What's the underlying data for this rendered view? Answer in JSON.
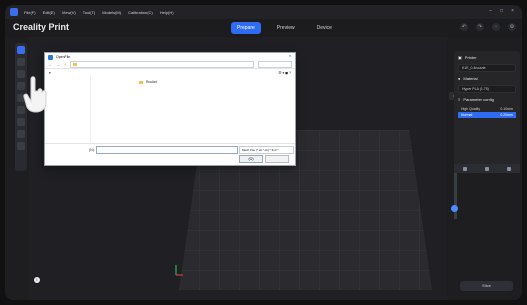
{
  "menubar": {
    "items": [
      "File(F)",
      "Edit(E)",
      "View(V)",
      "Tool(T)",
      "Models(M)",
      "Calibration(C)",
      "Help(H)"
    ]
  },
  "app": {
    "name": "Creality Print"
  },
  "tabs": [
    {
      "label": "Prepare"
    },
    {
      "label": "Preview"
    },
    {
      "label": "Device"
    }
  ],
  "dialog": {
    "title": "OpenFile",
    "folder_item": "Rocket",
    "filename_label": "(N):",
    "filter": "Mesh File (*.stl *.obj *.3mf *.",
    "open_label": "(O)"
  },
  "right_panel": {
    "printer": {
      "title": "Printer",
      "value": "K1E_0.4nozzle"
    },
    "material": {
      "title": "Material",
      "value": "Hyper PLA (1.75)"
    },
    "param": {
      "title": "Parameter config",
      "rows": [
        {
          "name": "High Quality",
          "value": "0.10mm"
        },
        {
          "name": "Normal",
          "value": "0.20mm"
        }
      ]
    }
  },
  "slice": {
    "label": "Slice"
  },
  "colors": {
    "accent": "#2f6cf6",
    "bg": "#1e1e20"
  }
}
